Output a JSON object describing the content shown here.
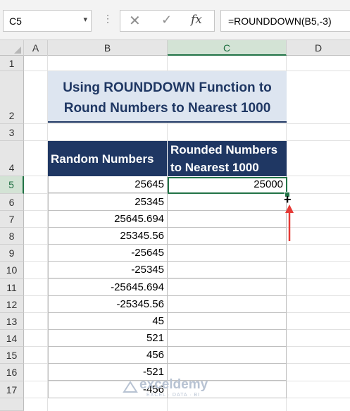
{
  "formula_bar": {
    "name_box": "C5",
    "formula": "=ROUNDDOWN(B5,-3)"
  },
  "columns": [
    "A",
    "B",
    "C",
    "D"
  ],
  "rows": [
    "1",
    "2",
    "3",
    "4",
    "5",
    "6",
    "7",
    "8",
    "9",
    "10",
    "11",
    "12",
    "13",
    "14",
    "15",
    "16",
    "17"
  ],
  "title": {
    "line1": "Using ROUNDDOWN Function to",
    "line2": "Round Numbers to Nearest 1000"
  },
  "table": {
    "header_b": "Random Numbers",
    "header_c_line1": "Rounded Numbers",
    "header_c_line2": "to Nearest 1000",
    "random_numbers": [
      "25645",
      "25345",
      "25645.694",
      "25345.56",
      "-25645",
      "-25345",
      "-25645.694",
      "-25345.56",
      "45",
      "521",
      "456",
      "-521",
      "-456"
    ],
    "rounded": [
      "25000",
      "",
      "",
      "",
      "",
      "",
      "",
      "",
      "",
      "",
      "",
      "",
      ""
    ]
  },
  "watermark": {
    "name": "exceldemy",
    "tagline": "EXCEL · DATA · BI"
  },
  "colors": {
    "header_bg": "#1f3763",
    "title_bg": "#dde5f0",
    "selection": "#217346",
    "arrow": "#e53935"
  }
}
